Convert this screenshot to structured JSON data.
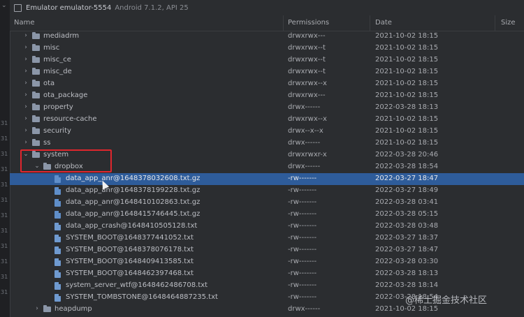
{
  "window": {
    "title": "Emulator emulator-5554",
    "subtitle": "Android 7.1.2, API 25"
  },
  "columns": {
    "name": "Name",
    "permissions": "Permissions",
    "date": "Date",
    "size": "Size"
  },
  "gutter_numbers": [
    "31",
    "31",
    "31",
    "31",
    "31",
    "31",
    "31",
    "31",
    "31",
    "31",
    "31",
    "31"
  ],
  "rows": [
    {
      "name": "mediadrm",
      "perm": "drwxrwx---",
      "date": "2021-10-02 18:15",
      "type": "folder",
      "depth": 1,
      "expanded": false
    },
    {
      "name": "misc",
      "perm": "drwxrwx--t",
      "date": "2021-10-02 18:15",
      "type": "folder",
      "depth": 1,
      "expanded": false
    },
    {
      "name": "misc_ce",
      "perm": "drwxrwx--t",
      "date": "2021-10-02 18:15",
      "type": "folder",
      "depth": 1,
      "expanded": false
    },
    {
      "name": "misc_de",
      "perm": "drwxrwx--t",
      "date": "2021-10-02 18:15",
      "type": "folder",
      "depth": 1,
      "expanded": false
    },
    {
      "name": "ota",
      "perm": "drwxrwx--x",
      "date": "2021-10-02 18:15",
      "type": "folder",
      "depth": 1,
      "expanded": false
    },
    {
      "name": "ota_package",
      "perm": "drwxrwx---",
      "date": "2021-10-02 18:15",
      "type": "folder",
      "depth": 1,
      "expanded": false
    },
    {
      "name": "property",
      "perm": "drwx------",
      "date": "2022-03-28 18:13",
      "type": "folder",
      "depth": 1,
      "expanded": false
    },
    {
      "name": "resource-cache",
      "perm": "drwxrwx--x",
      "date": "2021-10-02 18:15",
      "type": "folder",
      "depth": 1,
      "expanded": false
    },
    {
      "name": "security",
      "perm": "drwx--x--x",
      "date": "2021-10-02 18:15",
      "type": "folder",
      "depth": 1,
      "expanded": false
    },
    {
      "name": "ss",
      "perm": "drwx------",
      "date": "2021-10-02 18:15",
      "type": "folder",
      "depth": 1,
      "expanded": false
    },
    {
      "name": "system",
      "perm": "drwxrwxr-x",
      "date": "2022-03-28 20:46",
      "type": "folder",
      "depth": 1,
      "expanded": true
    },
    {
      "name": "dropbox",
      "perm": "drwx------",
      "date": "2022-03-28 18:54",
      "type": "folder",
      "depth": 2,
      "expanded": true
    },
    {
      "name": "data_app_anr@1648378032608.txt.gz",
      "perm": "-rw-------",
      "date": "2022-03-27 18:47",
      "type": "file-gz",
      "depth": 3,
      "selected": true
    },
    {
      "name": "data_app_anr@1648378199228.txt.gz",
      "perm": "-rw-------",
      "date": "2022-03-27 18:49",
      "type": "file-gz",
      "depth": 3
    },
    {
      "name": "data_app_anr@1648410102863.txt.gz",
      "perm": "-rw-------",
      "date": "2022-03-28 03:41",
      "type": "file-gz",
      "depth": 3
    },
    {
      "name": "data_app_anr@1648415746445.txt.gz",
      "perm": "-rw-------",
      "date": "2022-03-28 05:15",
      "type": "file-gz",
      "depth": 3
    },
    {
      "name": "data_app_crash@1648410505128.txt",
      "perm": "-rw-------",
      "date": "2022-03-28 03:48",
      "type": "file",
      "depth": 3
    },
    {
      "name": "SYSTEM_BOOT@1648377441052.txt",
      "perm": "-rw-------",
      "date": "2022-03-27 18:37",
      "type": "file",
      "depth": 3
    },
    {
      "name": "SYSTEM_BOOT@1648378076178.txt",
      "perm": "-rw-------",
      "date": "2022-03-27 18:47",
      "type": "file",
      "depth": 3
    },
    {
      "name": "SYSTEM_BOOT@1648409413585.txt",
      "perm": "-rw-------",
      "date": "2022-03-28 03:30",
      "type": "file",
      "depth": 3
    },
    {
      "name": "SYSTEM_BOOT@1648462397468.txt",
      "perm": "-rw-------",
      "date": "2022-03-28 18:13",
      "type": "file",
      "depth": 3
    },
    {
      "name": "system_server_wtf@1648462486708.txt",
      "perm": "-rw-------",
      "date": "2022-03-28 18:14",
      "type": "file",
      "depth": 3
    },
    {
      "name": "SYSTEM_TOMBSTONE@1648464887235.txt",
      "perm": "-rw-------",
      "date": "2022-03-28 18:54",
      "type": "file",
      "depth": 3
    },
    {
      "name": "heapdump",
      "perm": "drwx------",
      "date": "2021-10-02 18:15",
      "type": "folder",
      "depth": 2,
      "expanded": false
    }
  ],
  "watermark": "@稀土掘金技术社区",
  "colors": {
    "background": "#2b2d30",
    "selection": "#2e5c9a",
    "highlight_box": "#e0262d",
    "folder": "#8b96a8",
    "file": "#6f9ad0"
  },
  "icons": {
    "collapsed": "chevron-right-icon",
    "expanded": "chevron-down-icon",
    "folder": "folder-icon",
    "file": "file-icon",
    "device": "device-icon"
  }
}
